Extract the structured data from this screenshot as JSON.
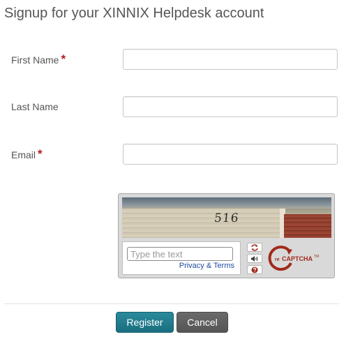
{
  "page": {
    "title": "Signup for your XINNIX Helpdesk account"
  },
  "form": {
    "first_name": {
      "label": "First Name",
      "required_mark": "*",
      "value": ""
    },
    "last_name": {
      "label": "Last Name",
      "value": ""
    },
    "email": {
      "label": "Email",
      "required_mark": "*",
      "value": ""
    }
  },
  "captcha": {
    "image_text": "516",
    "input_placeholder": "Type the text",
    "privacy_link": "Privacy & Terms",
    "icons": [
      "refresh-icon",
      "audio-icon",
      "help-icon"
    ],
    "logo_text": "reCAPTCHA",
    "logo_color": "#a12a1c"
  },
  "actions": {
    "register_label": "Register",
    "cancel_label": "Cancel",
    "register_color": "#1f7b8c",
    "cancel_color": "#5e5e5e"
  }
}
